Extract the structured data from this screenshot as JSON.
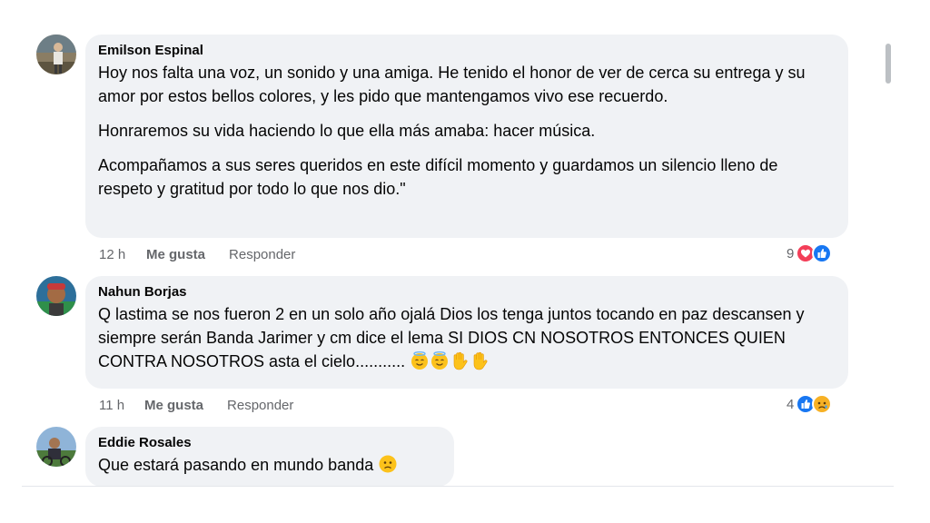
{
  "comments": [
    {
      "author": "Emilson Espinal",
      "paragraphs": [
        "Hoy nos falta una voz, un sonido y una amiga. He tenido el honor de ver de cerca su entrega y su amor por estos bellos colores, y les pido que mantengamos vivo ese recuerdo.",
        "Honraremos su vida haciendo lo que ella más amaba: hacer música.",
        "Acompañamos a sus seres queridos en este difícil momento y guardamos un silencio lleno de respeto y gratitud por todo lo que nos dio.\""
      ],
      "time": "12 h",
      "like_label": "Me gusta",
      "reply_label": "Responder",
      "reaction_count": "9",
      "reaction_icons": [
        "love-icon",
        "like-icon"
      ],
      "avatar_icon": "profile-photo-avatar"
    },
    {
      "author": "Nahun Borjas",
      "paragraphs": [
        "Q lastima se nos fueron 2 en un solo año ojalá Dios los tenga juntos tocando en paz descansen y siempre serán Banda Jarimer y cm dice el lema SI DIOS CN NOSOTROS ENTONCES QUIEN CONTRA NOSOTROS asta el cielo..........."
      ],
      "trailing_emoji": [
        "smiling-face-with-halo-emoji",
        "smiling-face-with-halo-emoji",
        "raised-hand-emoji",
        "raised-hand-emoji"
      ],
      "time": "11 h",
      "like_label": "Me gusta",
      "reply_label": "Responder",
      "reaction_count": "4",
      "reaction_icons": [
        "like-icon",
        "sad-icon"
      ],
      "avatar_icon": "profile-photo-avatar"
    },
    {
      "author": "Eddie Rosales",
      "text": "Que estará pasando en mundo banda",
      "trailing_emoji": [
        "sad-face-emoji"
      ],
      "avatar_icon": "profile-photo-avatar"
    }
  ],
  "colors": {
    "bubble": "#f0f2f5",
    "meta_text": "#65676b",
    "like_blue": "#1877f2",
    "love_red": "#f33e58",
    "sad_yellow": "#f7b125"
  }
}
